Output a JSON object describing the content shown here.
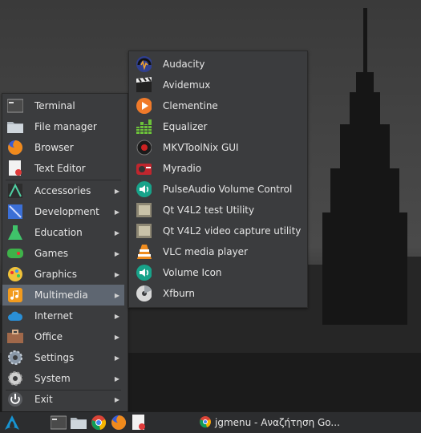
{
  "main_menu": {
    "items": [
      {
        "label": "Terminal",
        "icon": "terminal-icon"
      },
      {
        "label": "File manager",
        "icon": "folder-icon"
      },
      {
        "label": "Browser",
        "icon": "firefox-icon"
      },
      {
        "label": "Text Editor",
        "icon": "text-editor-icon"
      },
      {
        "label": "Accessories",
        "icon": "accessories-icon",
        "submenu": true
      },
      {
        "label": "Development",
        "icon": "development-icon",
        "submenu": true
      },
      {
        "label": "Education",
        "icon": "education-icon",
        "submenu": true
      },
      {
        "label": "Games",
        "icon": "games-icon",
        "submenu": true
      },
      {
        "label": "Graphics",
        "icon": "graphics-icon",
        "submenu": true
      },
      {
        "label": "Multimedia",
        "icon": "multimedia-icon",
        "submenu": true,
        "active": true
      },
      {
        "label": "Internet",
        "icon": "internet-icon",
        "submenu": true
      },
      {
        "label": "Office",
        "icon": "office-icon",
        "submenu": true
      },
      {
        "label": "Settings",
        "icon": "settings-icon",
        "submenu": true
      },
      {
        "label": "System",
        "icon": "system-icon",
        "submenu": true
      },
      {
        "label": "Exit",
        "icon": "power-icon",
        "submenu": true
      }
    ],
    "arrow": "▶"
  },
  "multimedia_menu": {
    "items": [
      {
        "label": "Audacity",
        "icon": "audacity-icon"
      },
      {
        "label": "Avidemux",
        "icon": "avidemux-icon"
      },
      {
        "label": "Clementine",
        "icon": "clementine-icon"
      },
      {
        "label": "Equalizer",
        "icon": "equalizer-icon"
      },
      {
        "label": "MKVToolNix GUI",
        "icon": "mkvtoolnix-icon"
      },
      {
        "label": "Myradio",
        "icon": "myradio-icon"
      },
      {
        "label": "PulseAudio Volume Control",
        "icon": "pulseaudio-icon"
      },
      {
        "label": "Qt V4L2 test Utility",
        "icon": "qt-v4l2-icon"
      },
      {
        "label": "Qt V4L2 video capture utility",
        "icon": "qt-v4l2-capture-icon"
      },
      {
        "label": "VLC media player",
        "icon": "vlc-icon"
      },
      {
        "label": "Volume Icon",
        "icon": "volume-icon"
      },
      {
        "label": "Xfburn",
        "icon": "xfburn-icon"
      }
    ]
  },
  "taskbar": {
    "launchers": [
      "arch-logo-icon",
      "terminal-icon",
      "file-manager-icon",
      "chrome-icon",
      "firefox-icon",
      "text-editor-icon"
    ],
    "task_title": "jgmenu - Αναζήτηση Go..."
  },
  "colors": {
    "menu_bg": "#3b3c3e",
    "active_bg": "#5e6671",
    "text": "#e6e6e6",
    "accent_blue": "#2a8fd6"
  }
}
